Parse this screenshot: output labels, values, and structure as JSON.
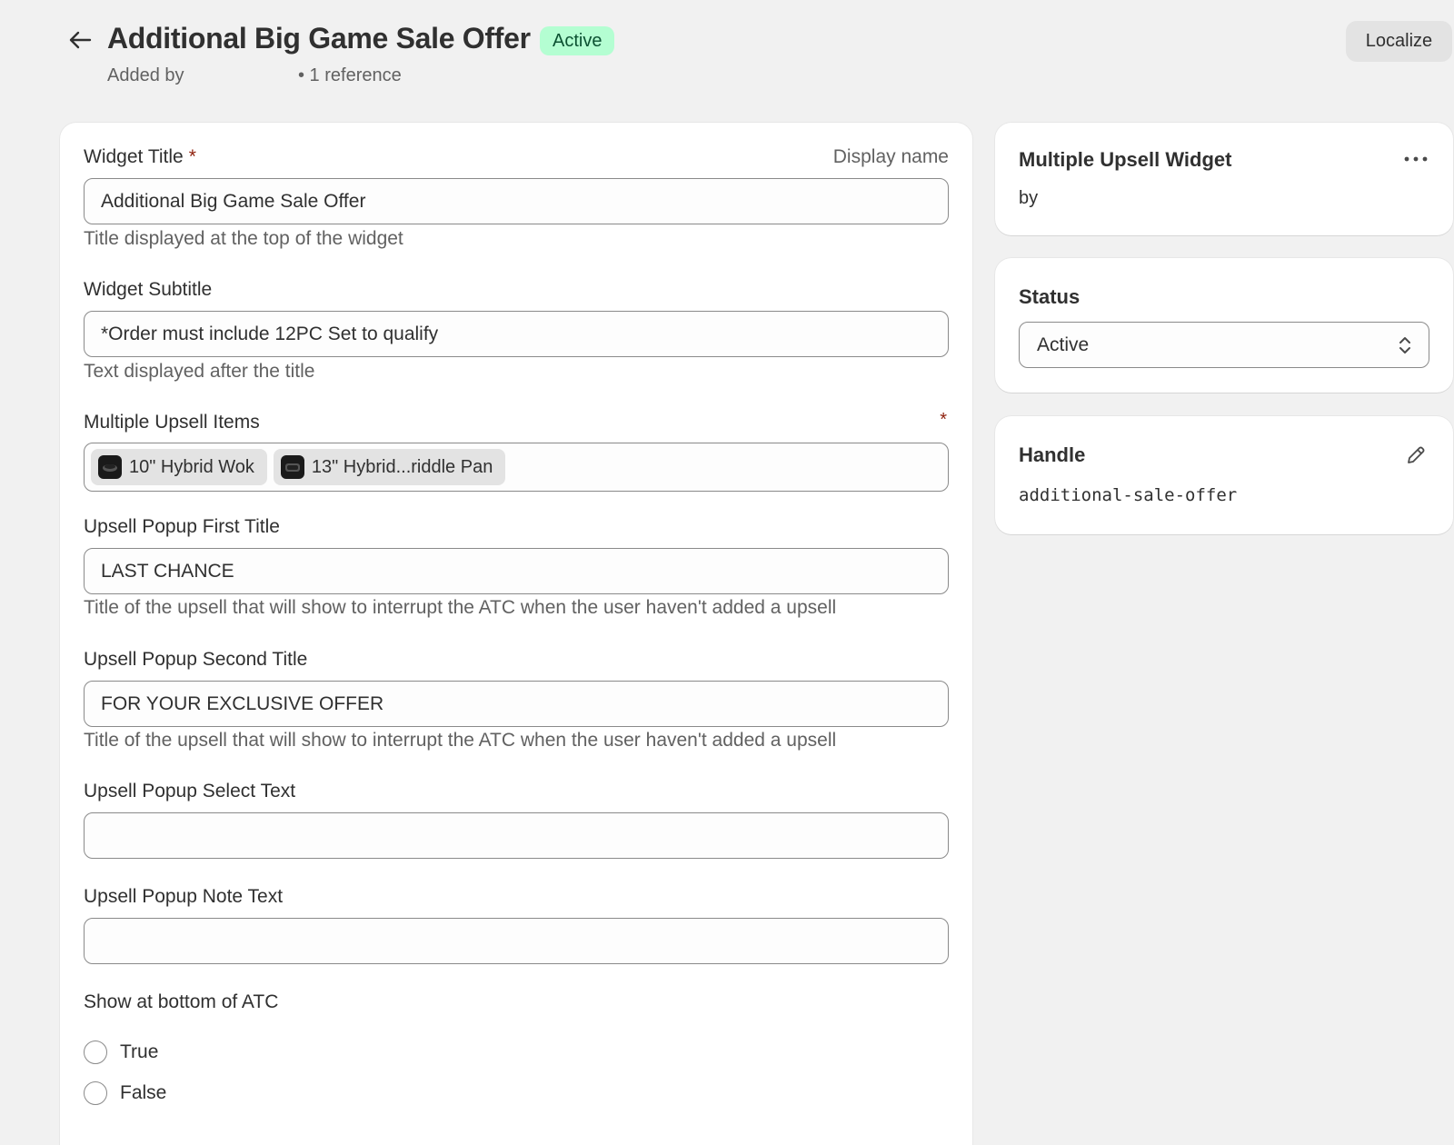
{
  "header": {
    "title": "Additional Big Game Sale Offer",
    "status_badge": "Active",
    "added_by": "Added by",
    "references": "• 1 reference",
    "localize_label": "Localize"
  },
  "form": {
    "widget_title": {
      "label": "Widget Title",
      "required_mark": "*",
      "right_label": "Display name",
      "value": "Additional Big Game Sale Offer",
      "help": "Title displayed at the top of the widget"
    },
    "widget_subtitle": {
      "label": "Widget Subtitle",
      "value": "*Order must include 12PC Set to qualify",
      "help": "Text displayed after the title"
    },
    "upsell_items": {
      "label": "Multiple Upsell Items",
      "required_mark": "*",
      "items": [
        {
          "label": "10\" Hybrid Wok"
        },
        {
          "label": "13\" Hybrid...riddle Pan"
        }
      ]
    },
    "popup_first_title": {
      "label": "Upsell Popup First Title",
      "value": "LAST CHANCE",
      "help": "Title of the upsell that will show to interrupt the ATC when the user haven't added a upsell"
    },
    "popup_second_title": {
      "label": "Upsell Popup Second Title",
      "value": "FOR YOUR EXCLUSIVE OFFER",
      "help": "Title of the upsell that will show to interrupt the ATC when the user haven't added a upsell"
    },
    "popup_select_text": {
      "label": "Upsell Popup Select Text",
      "value": ""
    },
    "popup_note_text": {
      "label": "Upsell Popup Note Text",
      "value": ""
    },
    "show_bottom_atc": {
      "label": "Show at bottom of ATC",
      "options": [
        {
          "label": "True"
        },
        {
          "label": "False"
        }
      ]
    }
  },
  "sidebar": {
    "definition": {
      "title": "Multiple Upsell Widget",
      "by": "by"
    },
    "status": {
      "title": "Status",
      "selected": "Active"
    },
    "handle": {
      "title": "Handle",
      "value": "additional-sale-offer"
    }
  },
  "colors": {
    "background": "#f1f1f1",
    "card": "#ffffff",
    "badge_bg": "#b4fed2",
    "badge_text": "#0c5132",
    "required": "#8e1f0b"
  },
  "icons": {
    "back": "arrow-left-icon",
    "more": "more-horizontal-icon",
    "select": "chevron-up-down-icon",
    "edit": "pencil-icon",
    "tag_thumb": "product-thumbnail-icon"
  }
}
